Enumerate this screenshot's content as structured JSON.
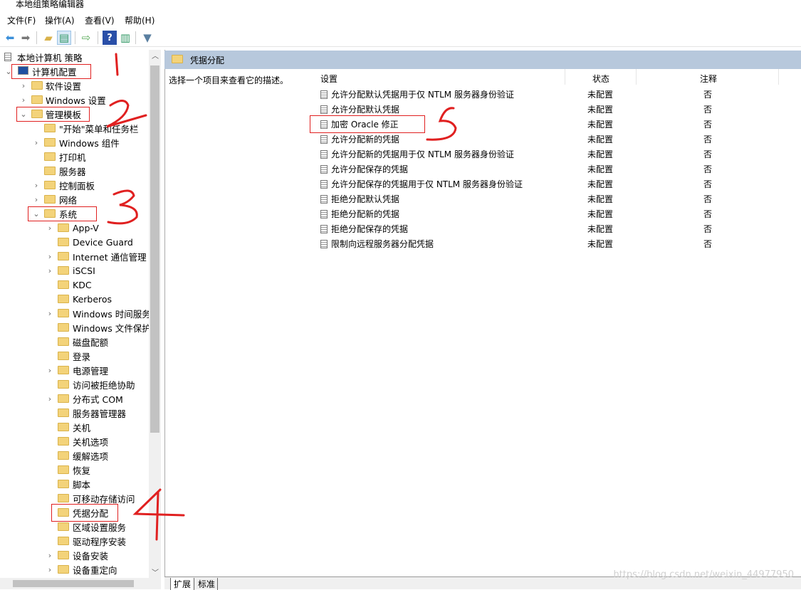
{
  "window": {
    "title": "本地组策略编辑器"
  },
  "menu": [
    "文件(F)",
    "操作(A)",
    "查看(V)",
    "帮助(H)"
  ],
  "toolbar": [
    "back-icon",
    "forward-icon",
    "up-folder-icon",
    "show-hide-tree-icon",
    "export-list-icon",
    "help-icon",
    "show-hide-action-pane-icon",
    "filter-icon"
  ],
  "tree": [
    {
      "label": "本地计算机 策略",
      "level": 0,
      "icon": "policy-doc"
    },
    {
      "label": "计算机配置",
      "level": 0,
      "expanded": true,
      "icon": "computer"
    },
    {
      "label": "软件设置",
      "level": 1,
      "arrow": true
    },
    {
      "label": "Windows 设置",
      "level": 1,
      "arrow": true
    },
    {
      "label": "管理模板",
      "level": 1,
      "expanded": true
    },
    {
      "label": "\"开始\"菜单和任务栏",
      "level": 2
    },
    {
      "label": "Windows 组件",
      "level": 2,
      "arrow": true
    },
    {
      "label": "打印机",
      "level": 2
    },
    {
      "label": "服务器",
      "level": 2
    },
    {
      "label": "控制面板",
      "level": 2,
      "arrow": true
    },
    {
      "label": "网络",
      "level": 2,
      "arrow": true
    },
    {
      "label": "系统",
      "level": 2,
      "expanded": true
    },
    {
      "label": "App-V",
      "level": 3,
      "arrow": true
    },
    {
      "label": "Device Guard",
      "level": 3
    },
    {
      "label": "Internet 通信管理",
      "level": 3,
      "arrow": true
    },
    {
      "label": "iSCSI",
      "level": 3,
      "arrow": true
    },
    {
      "label": "KDC",
      "level": 3
    },
    {
      "label": "Kerberos",
      "level": 3
    },
    {
      "label": "Windows 时间服务",
      "level": 3,
      "arrow": true
    },
    {
      "label": "Windows 文件保护",
      "level": 3
    },
    {
      "label": "磁盘配额",
      "level": 3
    },
    {
      "label": "登录",
      "level": 3
    },
    {
      "label": "电源管理",
      "level": 3,
      "arrow": true
    },
    {
      "label": "访问被拒绝协助",
      "level": 3
    },
    {
      "label": "分布式 COM",
      "level": 3,
      "arrow": true
    },
    {
      "label": "服务器管理器",
      "level": 3
    },
    {
      "label": "关机",
      "level": 3
    },
    {
      "label": "关机选项",
      "level": 3
    },
    {
      "label": "缓解选项",
      "level": 3
    },
    {
      "label": "恢复",
      "level": 3
    },
    {
      "label": "脚本",
      "level": 3
    },
    {
      "label": "可移动存储访问",
      "level": 3
    },
    {
      "label": "凭据分配",
      "level": 3,
      "selected": true
    },
    {
      "label": "区域设置服务",
      "level": 3
    },
    {
      "label": "驱动程序安装",
      "level": 3
    },
    {
      "label": "设备安装",
      "level": 3,
      "arrow": true
    },
    {
      "label": "设备重定向",
      "level": 3,
      "arrow": true
    }
  ],
  "main": {
    "header": "凭据分配",
    "description": "选择一个项目来查看它的描述。",
    "columns": [
      "设置",
      "状态",
      "注释"
    ],
    "rows": [
      [
        "允许分配默认凭据用于仅 NTLM 服务器身份验证",
        "未配置",
        "否"
      ],
      [
        "允许分配默认凭据",
        "未配置",
        "否"
      ],
      [
        "加密 Oracle 修正",
        "未配置",
        "否"
      ],
      [
        "允许分配新的凭据",
        "未配置",
        "否"
      ],
      [
        "允许分配新的凭据用于仅 NTLM 服务器身份验证",
        "未配置",
        "否"
      ],
      [
        "允许分配保存的凭据",
        "未配置",
        "否"
      ],
      [
        "允许分配保存的凭据用于仅 NTLM 服务器身份验证",
        "未配置",
        "否"
      ],
      [
        "拒绝分配默认凭据",
        "未配置",
        "否"
      ],
      [
        "拒绝分配新的凭据",
        "未配置",
        "否"
      ],
      [
        "拒绝分配保存的凭据",
        "未配置",
        "否"
      ],
      [
        "限制向远程服务器分配凭据",
        "未配置",
        "否"
      ]
    ],
    "tabs": [
      "扩展",
      "标准"
    ]
  },
  "watermark": "https://blog.csdn.net/weixin_44977950",
  "annotation_color": "#e02020"
}
